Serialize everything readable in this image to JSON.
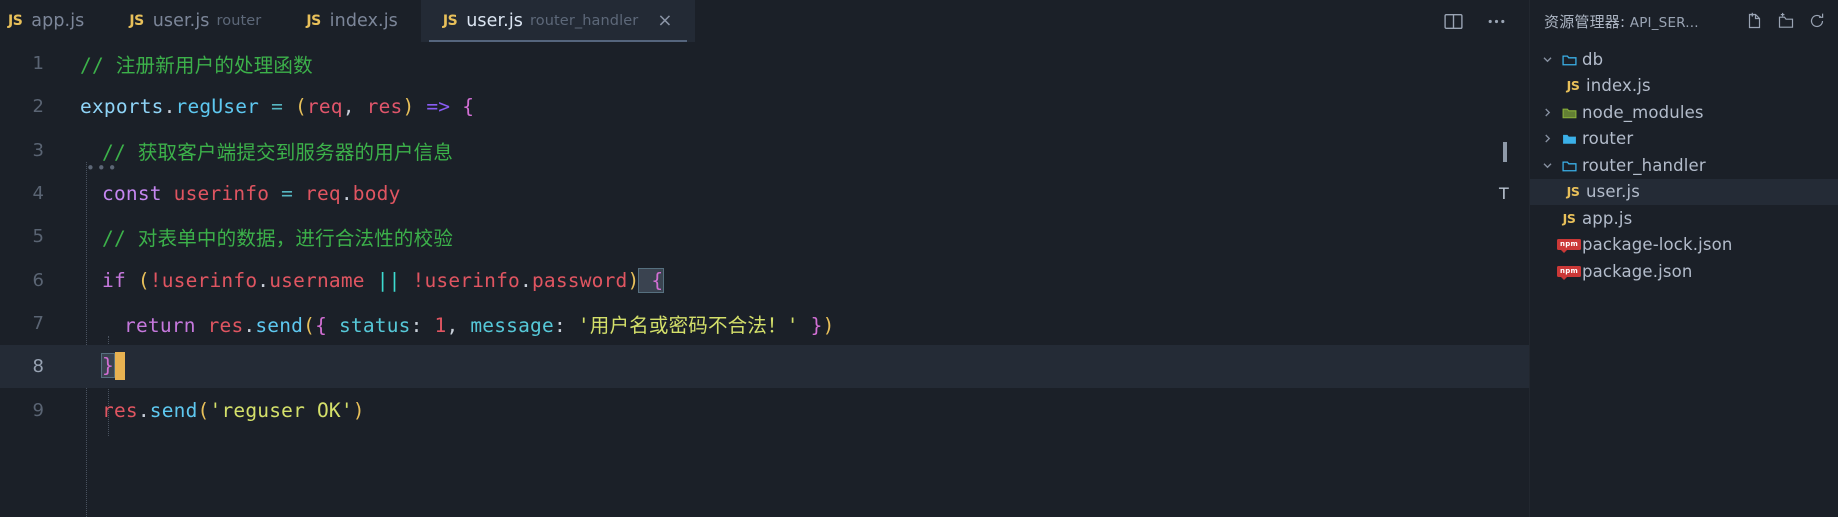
{
  "window": {
    "background": "#1b2028",
    "accent": "#e8b251"
  },
  "tabs": [
    {
      "name": "app.js",
      "desc": "",
      "icon": "js-file-icon",
      "active": false,
      "closable": false
    },
    {
      "name": "user.js",
      "desc": "router",
      "icon": "js-file-icon",
      "active": false,
      "closable": false
    },
    {
      "name": "index.js",
      "desc": "",
      "icon": "js-file-icon",
      "active": false,
      "closable": false
    },
    {
      "name": "user.js",
      "desc": "router_handler",
      "icon": "js-file-icon",
      "active": true,
      "closable": true,
      "close_label": "×"
    }
  ],
  "tabbar_actions": [
    {
      "name": "split-editor-icon",
      "label": ""
    },
    {
      "name": "more-actions-icon",
      "label": "…"
    }
  ],
  "editor": {
    "language": "javascript",
    "cursor_line": 8,
    "gutter": [
      "1",
      "2",
      "3",
      "4",
      "5",
      "6",
      "7",
      "8",
      "9"
    ],
    "fold_marker": "•••",
    "lines": [
      {
        "n": "1",
        "text": "// 注册新用户的处理函数"
      },
      {
        "n": "2",
        "text": "exports.regUser = (req, res) => {"
      },
      {
        "n": "3",
        "text": "  // 获取客户端提交到服务器的用户信息"
      },
      {
        "n": "4",
        "text": "  const userinfo = req.body"
      },
      {
        "n": "5",
        "text": "  // 对表单中的数据，进行合法性的校验"
      },
      {
        "n": "6",
        "text": "  if (!userinfo.username || !userinfo.password) {"
      },
      {
        "n": "7",
        "text": "    return res.send({ status: 1, message: '用户名或密码不合法！' })"
      },
      {
        "n": "8",
        "text": "  }"
      },
      {
        "n": "9",
        "text": "  res.send('reguser OK')"
      }
    ],
    "tokens": {
      "l1_comment": "// 注册新用户的处理函数",
      "l2_exports": "exports",
      "l2_dot": ".",
      "l2_regUser": "regUser",
      "l2_eq": " = ",
      "l2_lparen": "(",
      "l2_req": "req",
      "l2_comma": ", ",
      "l2_res": "res",
      "l2_rparen": ")",
      "l2_arrow": " => ",
      "l2_brace": "{",
      "l3_comment": "// 获取客户端提交到服务器的用户信息",
      "l4_const": "const",
      "l4_userinfo": " userinfo",
      "l4_eq": " = ",
      "l4_req": "req",
      "l4_dot": ".",
      "l4_body": "body",
      "l5_comment": "// 对表单中的数据，进行合法性的校验",
      "l6_if": "if",
      "l6_lparen": " (",
      "l6_bang1": "!",
      "l6_userinfo1": "userinfo",
      "l6_dot1": ".",
      "l6_username": "username",
      "l6_or": " || ",
      "l6_bang2": "!",
      "l6_userinfo2": "userinfo",
      "l6_dot2": ".",
      "l6_password": "password",
      "l6_rparen": ")",
      "l6_brace": " {",
      "l7_return": "return",
      "l7_res": " res",
      "l7_dot": ".",
      "l7_send": "send",
      "l7_lparen": "(",
      "l7_obrace": "{ ",
      "l7_status": "status",
      "l7_colon1": ": ",
      "l7_one": "1",
      "l7_comma": ", ",
      "l7_message": "message",
      "l7_colon2": ": ",
      "l7_string": "'用户名或密码不合法！'",
      "l7_cbrace": " }",
      "l7_rparen": ")",
      "l8_brace": "}",
      "l9_res": "res",
      "l9_dot": ".",
      "l9_send": "send",
      "l9_lparen": "(",
      "l9_string": "'reguser OK'",
      "l9_rparen": ")"
    }
  },
  "minimap": {
    "markers": [
      {
        "kind": "bar",
        "label": ""
      },
      {
        "kind": "text",
        "label": "T"
      }
    ]
  },
  "explorer": {
    "title_prefix": "资源管理器:",
    "title_project": "API_SER...",
    "actions": [
      {
        "name": "new-file-icon",
        "label": ""
      },
      {
        "name": "new-folder-icon",
        "label": ""
      },
      {
        "name": "refresh-icon",
        "label": ""
      }
    ],
    "tree": [
      {
        "label": "db",
        "type": "folder",
        "expanded": true,
        "depth": 0,
        "selected": false,
        "icon": "folder-open-icon"
      },
      {
        "label": "index.js",
        "type": "js",
        "expanded": null,
        "depth": 1,
        "selected": false,
        "icon": "js-file-icon"
      },
      {
        "label": "node_modules",
        "type": "folder",
        "expanded": false,
        "depth": 0,
        "selected": false,
        "icon": "folder-node-icon"
      },
      {
        "label": "router",
        "type": "folder",
        "expanded": false,
        "depth": 0,
        "selected": false,
        "icon": "folder-icon"
      },
      {
        "label": "router_handler",
        "type": "folder",
        "expanded": true,
        "depth": 0,
        "selected": false,
        "icon": "folder-open-icon"
      },
      {
        "label": "user.js",
        "type": "js",
        "expanded": null,
        "depth": 1,
        "selected": true,
        "icon": "js-file-icon"
      },
      {
        "label": "app.js",
        "type": "js",
        "expanded": null,
        "depth": 0,
        "selected": false,
        "icon": "js-file-icon"
      },
      {
        "label": "package-lock.json",
        "type": "npm",
        "expanded": null,
        "depth": 0,
        "selected": false,
        "icon": "npm-file-icon",
        "badge": "npm"
      },
      {
        "label": "package.json",
        "type": "npm",
        "expanded": null,
        "depth": 0,
        "selected": false,
        "icon": "npm-file-icon",
        "badge": "npm"
      }
    ]
  }
}
